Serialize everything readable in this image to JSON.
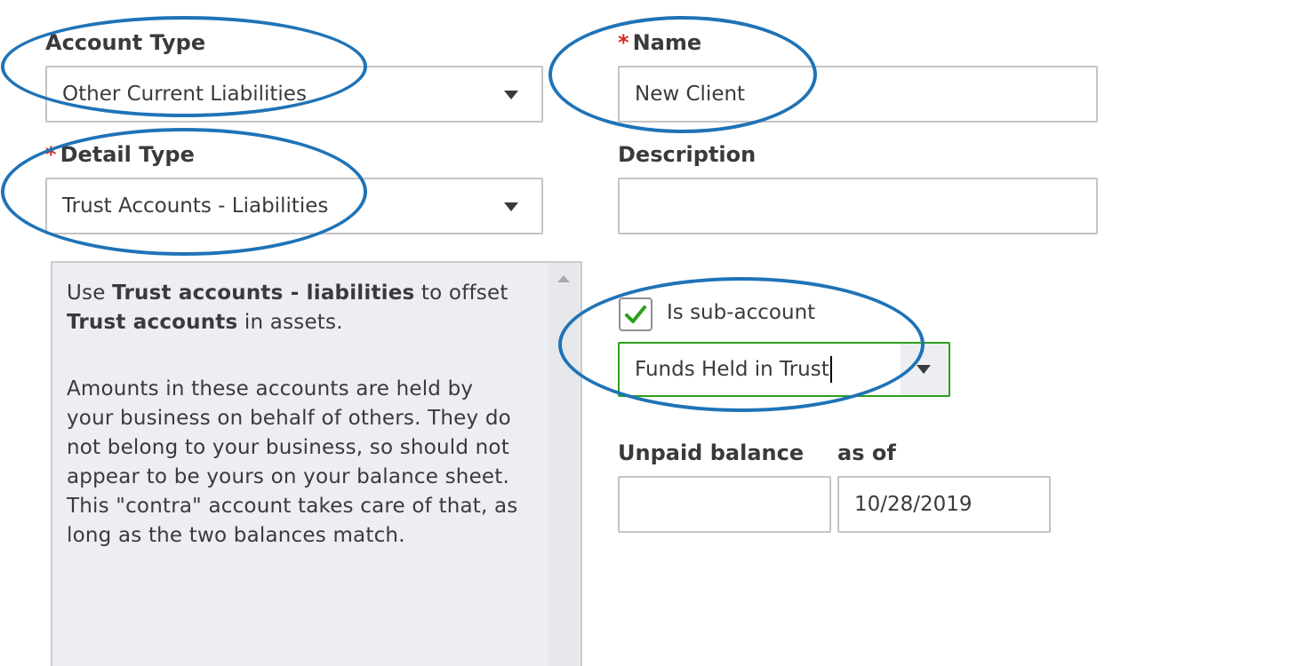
{
  "form": {
    "account_type": {
      "label": "Account Type",
      "value": "Other Current Liabilities"
    },
    "name": {
      "required_mark": "*",
      "label": "Name",
      "value": "New Client"
    },
    "detail_type": {
      "required_mark": "*",
      "label": "Detail Type",
      "value": "Trust Accounts - Liabilities"
    },
    "description": {
      "label": "Description",
      "value": ""
    },
    "help": {
      "p1_prefix": "Use ",
      "p1_bold1": "Trust accounts - liabilities",
      "p1_mid": " to offset ",
      "p1_bold2": "Trust accounts",
      "p1_suffix": " in assets.",
      "p2": "Amounts in these accounts are held by your business on behalf of others. They do not belong to your business, so should not appear to be yours on your balance sheet. This \"contra\" account takes care of that, as long as the two balances match."
    },
    "sub_account": {
      "checkbox_label": "Is sub-account",
      "checked": true,
      "parent_value": "Funds Held in Trust"
    },
    "unpaid_balance": {
      "label": "Unpaid balance",
      "value": ""
    },
    "as_of": {
      "label": "as of",
      "value": "10/28/2019"
    }
  },
  "colors": {
    "annotation_circle": "#1f73b7",
    "required_asterisk": "#d52b1e",
    "checkmark": "#2ca01c",
    "focus_border": "#2ca01c",
    "help_background": "#eceef1"
  },
  "icons": {
    "dropdown": "chevron-down-icon",
    "check": "checkmark-icon",
    "scroll": "scroll-up-icon"
  }
}
